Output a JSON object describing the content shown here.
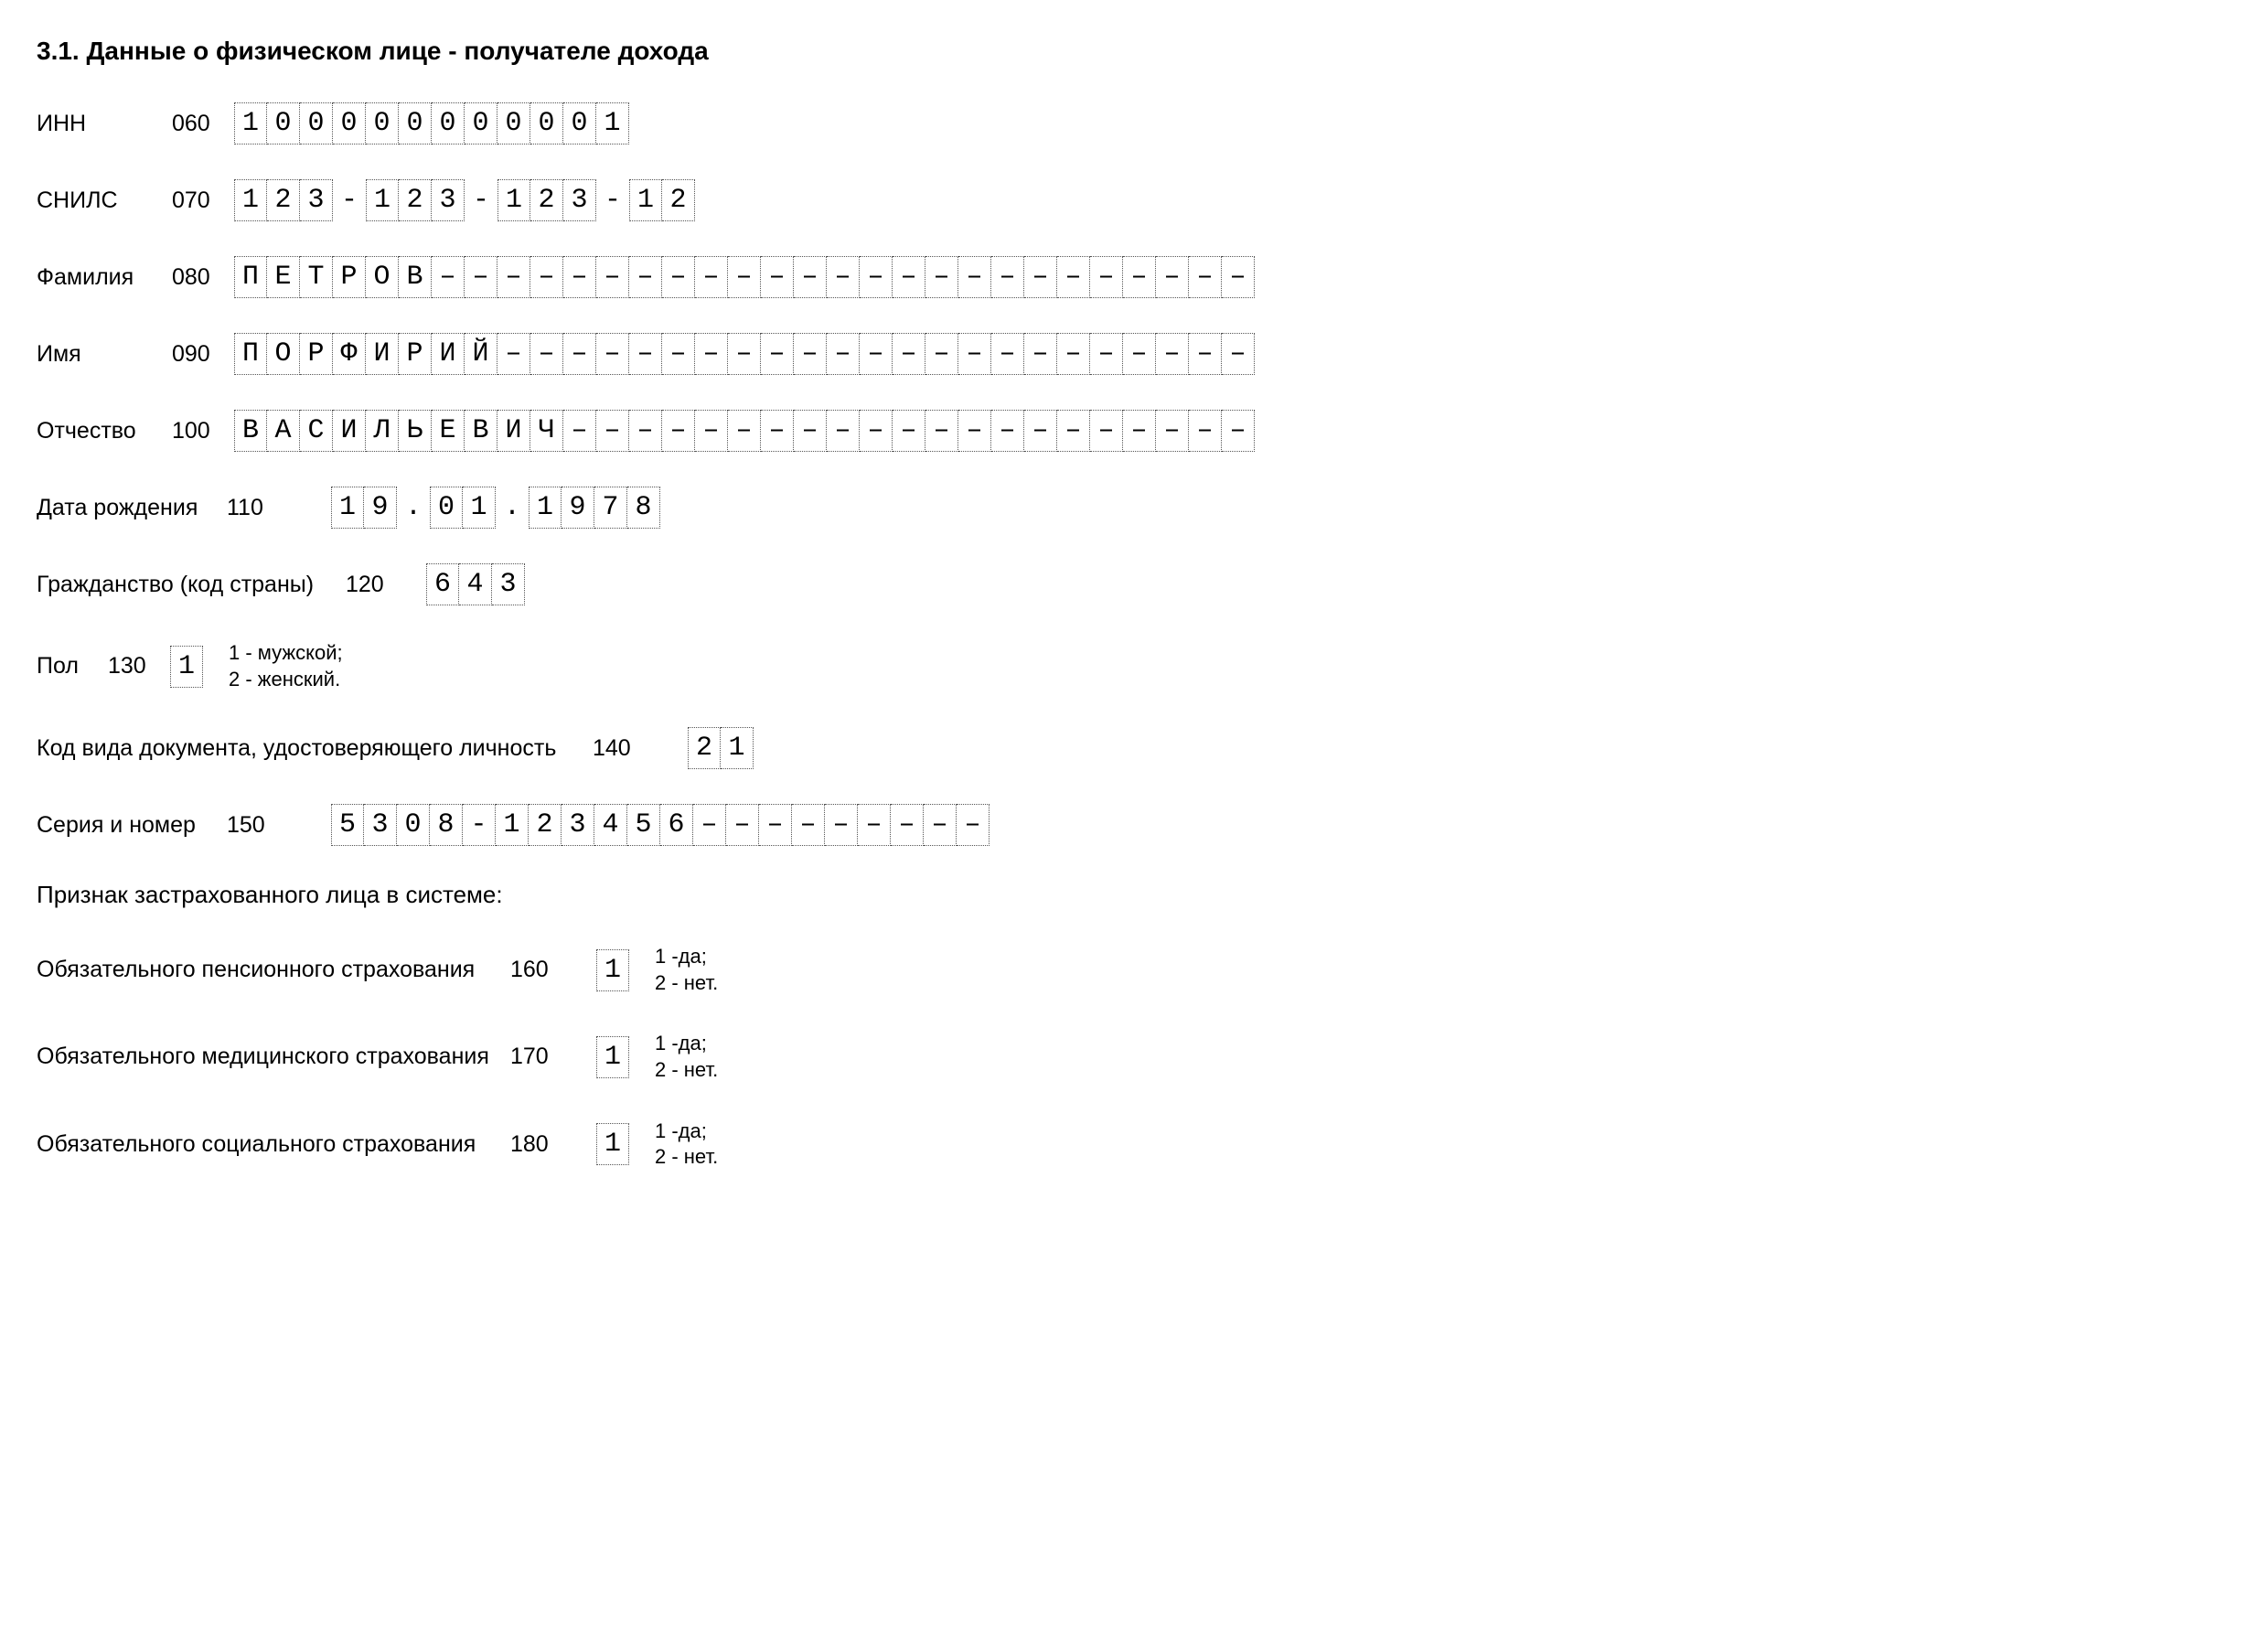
{
  "heading": "3.1. Данные о физическом лице - получателе дохода",
  "subheading": "Признак застрахованного лица в системе:",
  "fields": {
    "inn": {
      "label": "ИНН",
      "code": "060",
      "cells": [
        "1",
        "0",
        "0",
        "0",
        "0",
        "0",
        "0",
        "0",
        "0",
        "0",
        "0",
        "1"
      ]
    },
    "snils": {
      "label": "СНИЛС",
      "code": "070",
      "groups": [
        [
          "1",
          "2",
          "3"
        ],
        [
          "1",
          "2",
          "3"
        ],
        [
          "1",
          "2",
          "3"
        ],
        [
          "1",
          "2"
        ]
      ],
      "sep": "-"
    },
    "surname": {
      "label": "Фамилия",
      "code": "080",
      "value": "ПЕТРОВ",
      "cells": 31
    },
    "name": {
      "label": "Имя",
      "code": "090",
      "value": "ПОРФИРИЙ",
      "cells": 31
    },
    "patronymic": {
      "label": "Отчество",
      "code": "100",
      "value": "ВАСИЛЬЕВИЧ",
      "cells": 31
    },
    "dob": {
      "label": "Дата рождения",
      "code": "110",
      "groups": [
        [
          "1",
          "9"
        ],
        [
          "0",
          "1"
        ],
        [
          "1",
          "9",
          "7",
          "8"
        ]
      ],
      "sep": "."
    },
    "citizenship": {
      "label": "Гражданство (код страны)",
      "code": "120",
      "cells": [
        "6",
        "4",
        "3"
      ]
    },
    "sex": {
      "label": "Пол",
      "code": "130",
      "cells": [
        "1"
      ],
      "legend": "1 - мужской;\n2 - женский."
    },
    "doctype": {
      "label": "Код вида документа, удостоверяющего личность",
      "code": "140",
      "cells": [
        "2",
        "1"
      ]
    },
    "docnum": {
      "label": "Серия и номер",
      "code": "150",
      "value": "5308-123456",
      "cells": 20
    },
    "pension": {
      "label": "Обязательного пенсионного страхования",
      "code": "160",
      "cells": [
        "1"
      ],
      "legend": "1 -да;\n2 - нет."
    },
    "medical": {
      "label": "Обязательного медицинского страхования",
      "code": "170",
      "cells": [
        "1"
      ],
      "legend": "1 -да;\n2 - нет."
    },
    "social": {
      "label": "Обязательного социального страхования",
      "code": "180",
      "cells": [
        "1"
      ],
      "legend": "1 -да;\n2 - нет."
    }
  }
}
